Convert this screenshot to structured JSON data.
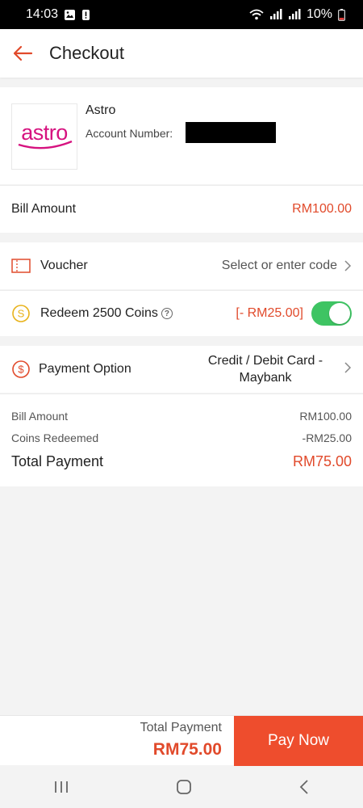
{
  "status_bar": {
    "time": "14:03",
    "battery_percent": "10%"
  },
  "header": {
    "title": "Checkout"
  },
  "merchant": {
    "logo_text": "astro",
    "name": "Astro",
    "account_label": "Account Number:"
  },
  "bill": {
    "label": "Bill Amount",
    "amount": "RM100.00"
  },
  "voucher": {
    "label": "Voucher",
    "placeholder": "Select or enter code"
  },
  "coins": {
    "label": "Redeem 2500 Coins",
    "help": "?",
    "discount": "[- RM25.00]",
    "toggle_on": true
  },
  "payment": {
    "label": "Payment Option",
    "value_line1": "Credit / Debit Card -",
    "value_line2": "Maybank"
  },
  "summary": {
    "bill_label": "Bill Amount",
    "bill_value": "RM100.00",
    "coins_label": "Coins Redeemed",
    "coins_value": "-RM25.00",
    "total_label": "Total Payment",
    "total_value": "RM75.00"
  },
  "bottom": {
    "total_label": "Total Payment",
    "total_amount": "RM75.00",
    "pay_now": "Pay Now"
  },
  "colors": {
    "accent": "#ee4d2d",
    "price": "#e14a2b",
    "toggle": "#3ec463",
    "astro_logo": "#d6127f"
  }
}
